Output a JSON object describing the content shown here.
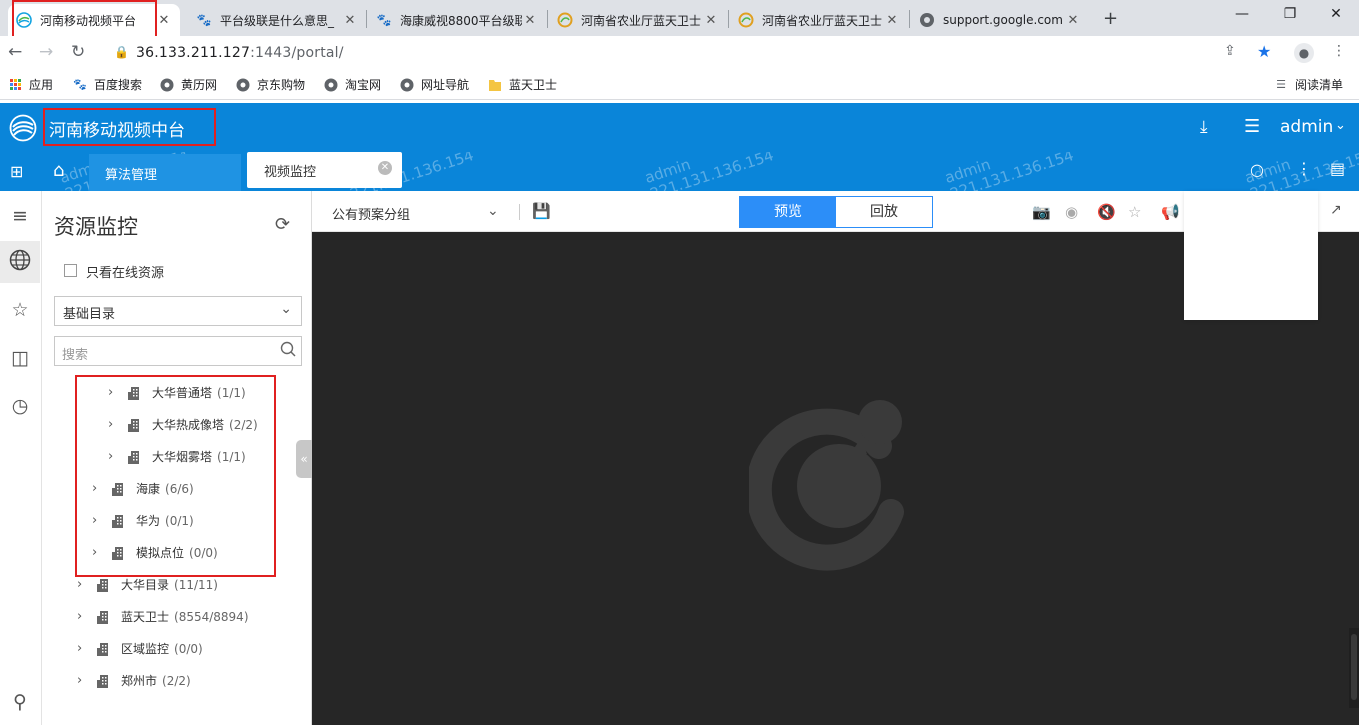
{
  "browser": {
    "tabs": [
      {
        "title": "河南移动视频平台",
        "favicon": "chinamobile-favicon"
      },
      {
        "title": "平台级联是什么意思_",
        "favicon": "baidu-paw-favicon"
      },
      {
        "title": "海康威视8800平台级联",
        "favicon": "baidu-paw-favicon"
      },
      {
        "title": "河南省农业厅蓝天卫士",
        "favicon": "agri-swirl-favicon"
      },
      {
        "title": "河南省农业厅蓝天卫士",
        "favicon": "agri-swirl-favicon"
      },
      {
        "title": "support.google.com",
        "favicon": "globe-favicon"
      }
    ],
    "url_host": "36.133.211.127",
    "url_rest": ":1443/portal/",
    "bookmarks": [
      {
        "label": "应用",
        "icon": "apps-grid-icon"
      },
      {
        "label": "百度搜索",
        "icon": "baidu-paw-icon"
      },
      {
        "label": "黄历网",
        "icon": "globe-icon"
      },
      {
        "label": "京东购物",
        "icon": "globe-icon"
      },
      {
        "label": "淘宝网",
        "icon": "globe-icon"
      },
      {
        "label": "网址导航",
        "icon": "globe-icon"
      },
      {
        "label": "蓝天卫士",
        "icon": "folder-icon"
      }
    ],
    "reading_list": "阅读清单"
  },
  "app": {
    "title": "河南移动视频中台",
    "user": "admin",
    "nav_tabs": [
      {
        "label": "算法管理"
      },
      {
        "label": "视频监控"
      }
    ],
    "watermark": {
      "user": "admin",
      "ip": "221.131.136.154"
    }
  },
  "panel": {
    "title": "资源监控",
    "only_online_label": "只看在线资源",
    "catalog_select": "基础目录",
    "search_placeholder": "搜索",
    "tree": [
      {
        "label": "大华普通塔",
        "count": "(1/1)"
      },
      {
        "label": "大华热成像塔",
        "count": "(2/2)"
      },
      {
        "label": "大华烟雾塔",
        "count": "(1/1)"
      },
      {
        "label": "海康",
        "count": "(6/6)"
      },
      {
        "label": "华为",
        "count": "(0/1)"
      },
      {
        "label": "模拟点位",
        "count": "(0/0)"
      },
      {
        "label": "大华目录",
        "count": "(11/11)"
      },
      {
        "label": "蓝天卫士",
        "count": "(8554/8894)"
      },
      {
        "label": "区域监控",
        "count": "(0/0)"
      },
      {
        "label": "郑州市",
        "count": "(2/2)"
      }
    ]
  },
  "video": {
    "group_select": "公有预案分组",
    "mode_preview": "预览",
    "mode_playback": "回放"
  },
  "colors": {
    "header_blue": "#0a85d9",
    "accent_blue": "#2c8ef8",
    "highlight_red": "#e02020",
    "stage_dark": "#262626"
  }
}
